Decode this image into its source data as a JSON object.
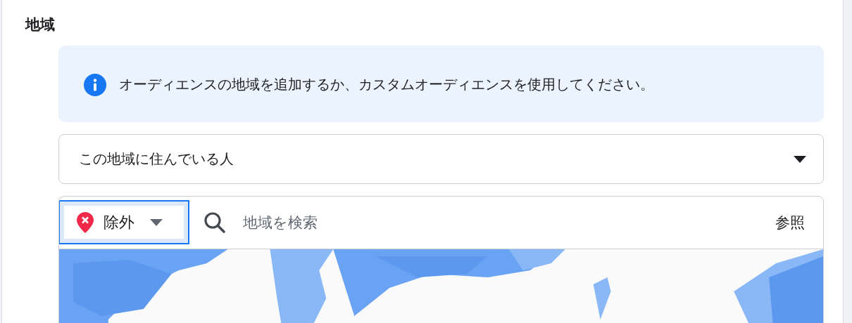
{
  "section": {
    "title": "地域"
  },
  "notice": {
    "text": "オーディエンスの地域を追加するか、カスタムオーディエンスを使用してください。"
  },
  "audience_select": {
    "value": "この地域に住んでいる人"
  },
  "location_search": {
    "mode": {
      "label": "除外",
      "kind": "exclude"
    },
    "placeholder": "地域を検索",
    "browse": "参照"
  }
}
